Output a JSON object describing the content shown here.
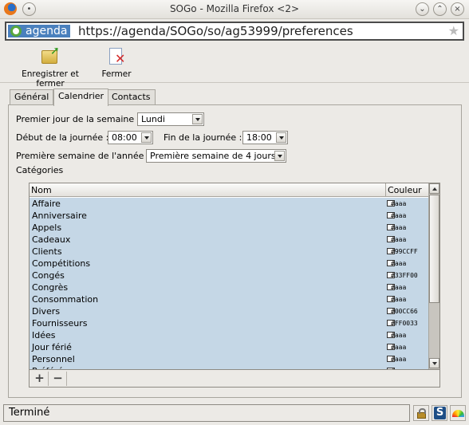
{
  "window": {
    "title": "SOGo - Mozilla Firefox <2>"
  },
  "urlbar": {
    "site_id": "agenda",
    "url": "https://agenda/SOGo/so/ag53999/preferences"
  },
  "toolbar": {
    "save_label": "Enregistrer et fermer",
    "close_label": "Fermer"
  },
  "tabs": [
    {
      "label": "Général",
      "active": false
    },
    {
      "label": "Calendrier",
      "active": true
    },
    {
      "label": "Contacts",
      "active": false
    }
  ],
  "calendar": {
    "first_day_label": "Premier jour de la semaine :",
    "first_day_value": "Lundi",
    "day_start_label": "Début de la journée :",
    "day_start_value": "08:00",
    "day_end_label": "Fin de la journée :",
    "day_end_value": "18:00",
    "first_week_label": "Première semaine de l'année :",
    "first_week_value": "Première semaine de 4 jours",
    "categories_label": "Catégories"
  },
  "categories_table": {
    "headers": {
      "name": "Nom",
      "color": "Couleur"
    },
    "rows": [
      {
        "name": "Affaire",
        "color": "#aaa"
      },
      {
        "name": "Anniversaire",
        "color": "#aaa"
      },
      {
        "name": "Appels",
        "color": "#aaa"
      },
      {
        "name": "Cadeaux",
        "color": "#aaa"
      },
      {
        "name": "Clients",
        "color": "#99CCFF"
      },
      {
        "name": "Compétitions",
        "color": "#aaa"
      },
      {
        "name": "Congés",
        "color": "#33FF00"
      },
      {
        "name": "Congrès",
        "color": "#aaa"
      },
      {
        "name": "Consommation",
        "color": "#aaa"
      },
      {
        "name": "Divers",
        "color": "#00CC66"
      },
      {
        "name": "Fournisseurs",
        "color": "#FF0033"
      },
      {
        "name": "Idées",
        "color": "#aaa"
      },
      {
        "name": "Jour férié",
        "color": "#aaa"
      },
      {
        "name": "Personnel",
        "color": "#aaa"
      },
      {
        "name": "Préférés",
        "color": "#aaa"
      }
    ],
    "add_label": "+",
    "remove_label": "−"
  },
  "status": {
    "text": "Terminé"
  }
}
